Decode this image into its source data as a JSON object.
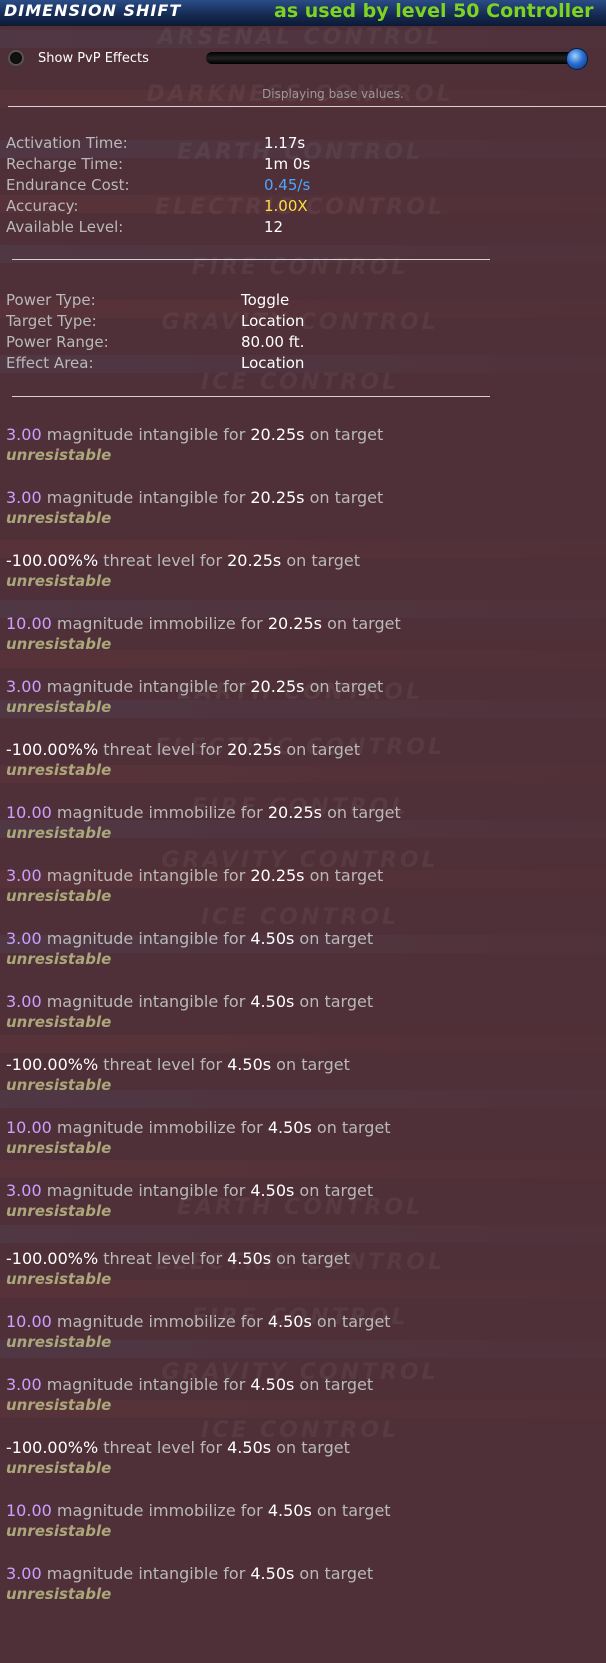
{
  "header": {
    "title": "DIMENSION SHIFT",
    "subtitle": "as used by level 50 Controller"
  },
  "pvp": {
    "label": "Show PvP Effects"
  },
  "status": "Displaying base values.",
  "stats": [
    {
      "label": "Activation Time:",
      "value": "1.17s",
      "color": "#ffffff"
    },
    {
      "label": "Recharge Time:",
      "value": "1m 0s",
      "color": "#ffffff"
    },
    {
      "label": "Endurance Cost:",
      "value": "0.45/s",
      "color": "#4fa6ff"
    },
    {
      "label": "Accuracy:",
      "value": "1.00X",
      "color": "#ffdd44"
    },
    {
      "label": "Available Level:",
      "value": "12",
      "color": "#ffffff"
    }
  ],
  "info": [
    {
      "label": "Power Type:",
      "value": "Toggle"
    },
    {
      "label": "Target Type:",
      "value": "Location"
    },
    {
      "label": "Power Range:",
      "value": "80.00 ft."
    },
    {
      "label": "Effect Area:",
      "value": "Location"
    }
  ],
  "watermarks": [
    "ARSENAL CONTROL",
    "DARKNESS CONTROL",
    "EARTH CONTROL",
    "ELECTRIC CONTROL",
    "FIRE CONTROL",
    "GRAVITY CONTROL",
    "ICE CONTROL"
  ],
  "effects": [
    {
      "value": "3.00",
      "text": "magnitude intangible for",
      "duration": "20.25s",
      "suffix": "on target",
      "tag": "unresistable",
      "kind": "mag"
    },
    {
      "value": "3.00",
      "text": "magnitude intangible for",
      "duration": "20.25s",
      "suffix": "on target",
      "tag": "unresistable",
      "kind": "mag"
    },
    {
      "value": "-100.00%%",
      "text": "threat level for",
      "duration": "20.25s",
      "suffix": "on target",
      "tag": "unresistable",
      "kind": "neg"
    },
    {
      "value": "10.00",
      "text": "magnitude immobilize for",
      "duration": "20.25s",
      "suffix": "on target",
      "tag": "unresistable",
      "kind": "mag"
    },
    {
      "value": "3.00",
      "text": "magnitude intangible for",
      "duration": "20.25s",
      "suffix": "on target",
      "tag": "unresistable",
      "kind": "mag"
    },
    {
      "value": "-100.00%%",
      "text": "threat level for",
      "duration": "20.25s",
      "suffix": "on target",
      "tag": "unresistable",
      "kind": "neg"
    },
    {
      "value": "10.00",
      "text": "magnitude immobilize for",
      "duration": "20.25s",
      "suffix": "on target",
      "tag": "unresistable",
      "kind": "mag"
    },
    {
      "value": "3.00",
      "text": "magnitude intangible for",
      "duration": "20.25s",
      "suffix": "on target",
      "tag": "unresistable",
      "kind": "mag"
    },
    {
      "value": "3.00",
      "text": "magnitude intangible for",
      "duration": "4.50s",
      "suffix": "on target",
      "tag": "unresistable",
      "kind": "mag"
    },
    {
      "value": "3.00",
      "text": "magnitude intangible for",
      "duration": "4.50s",
      "suffix": "on target",
      "tag": "unresistable",
      "kind": "mag"
    },
    {
      "value": "-100.00%%",
      "text": "threat level for",
      "duration": "4.50s",
      "suffix": "on target",
      "tag": "unresistable",
      "kind": "neg"
    },
    {
      "value": "10.00",
      "text": "magnitude immobilize for",
      "duration": "4.50s",
      "suffix": "on target",
      "tag": "unresistable",
      "kind": "mag"
    },
    {
      "value": "3.00",
      "text": "magnitude intangible for",
      "duration": "4.50s",
      "suffix": "on target",
      "tag": "unresistable",
      "kind": "mag"
    },
    {
      "value": "-100.00%%",
      "text": "threat level for",
      "duration": "4.50s",
      "suffix": "on target",
      "tag": "unresistable",
      "kind": "neg"
    },
    {
      "value": "10.00",
      "text": "magnitude immobilize for",
      "duration": "4.50s",
      "suffix": "on target",
      "tag": "unresistable",
      "kind": "mag"
    },
    {
      "value": "3.00",
      "text": "magnitude intangible for",
      "duration": "4.50s",
      "suffix": "on target",
      "tag": "unresistable",
      "kind": "mag"
    },
    {
      "value": "-100.00%%",
      "text": "threat level for",
      "duration": "4.50s",
      "suffix": "on target",
      "tag": "unresistable",
      "kind": "neg"
    },
    {
      "value": "10.00",
      "text": "magnitude immobilize for",
      "duration": "4.50s",
      "suffix": "on target",
      "tag": "unresistable",
      "kind": "mag"
    },
    {
      "value": "3.00",
      "text": "magnitude intangible for",
      "duration": "4.50s",
      "suffix": "on target",
      "tag": "unresistable",
      "kind": "mag"
    }
  ]
}
